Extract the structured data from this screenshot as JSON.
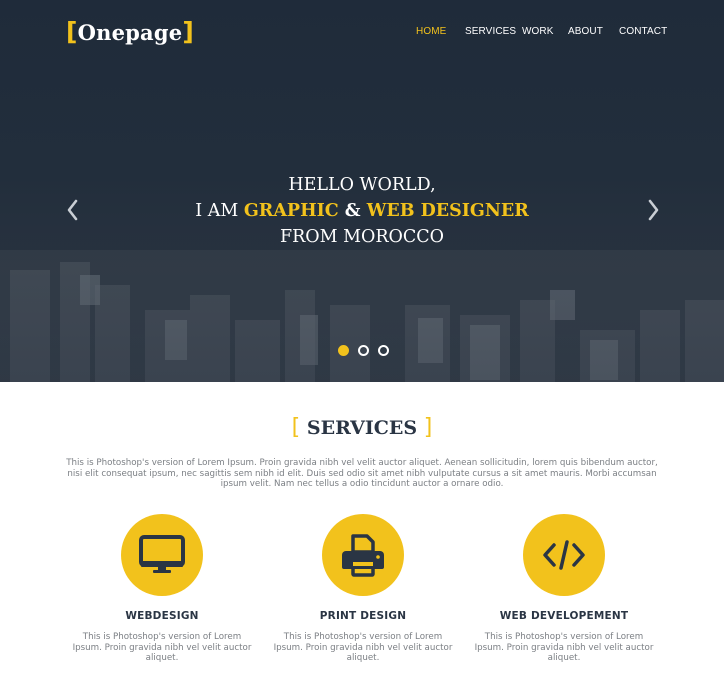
{
  "brand": {
    "logo_open": "[",
    "logo_text": "Onepage",
    "logo_close": "]",
    "accent_color": "#f2c21c",
    "dark_color": "#1f2b3a"
  },
  "nav": {
    "items": [
      {
        "label": "HOME",
        "active": true
      },
      {
        "label": "SERVICES",
        "active": false
      },
      {
        "label": "WORK",
        "active": false
      },
      {
        "label": "ABOUT",
        "active": false
      },
      {
        "label": "CONTACT",
        "active": false
      }
    ]
  },
  "hero": {
    "line1": "HELLO WORLD,",
    "line2_prefix": "I AM ",
    "line2_highlight1": "GRAPHIC",
    "line2_amp": " & ",
    "line2_highlight2": "WEB DESIGNER",
    "line3": "FROM MOROCCO",
    "prev_icon": "chevron-left-icon",
    "next_icon": "chevron-right-icon",
    "slides_total": 3,
    "active_slide": 1
  },
  "services": {
    "title_open": "[",
    "title": "SERVICES",
    "title_close": "]",
    "intro": "This is Photoshop's version  of Lorem Ipsum. Proin gravida nibh vel velit auctor aliquet. Aenean sollicitudin, lorem quis bibendum auctor, nisi elit consequat ipsum, nec sagittis sem nibh id elit. Duis sed odio sit amet nibh vulputate cursus a sit amet mauris. Morbi accumsan ipsum velit. Nam nec tellus a odio tincidunt auctor a ornare odio.",
    "items": [
      {
        "icon": "monitor-icon",
        "title": "WEBDESIGN",
        "text": "This is Photoshop's version  of Lorem Ipsum. Proin gravida nibh vel velit auctor aliquet."
      },
      {
        "icon": "printer-icon",
        "title": "PRINT DESIGN",
        "text": "This is Photoshop's version  of Lorem Ipsum. Proin gravida nibh vel velit auctor aliquet."
      },
      {
        "icon": "code-icon",
        "title": "WEB DEVELOPEMENT",
        "text": "This is Photoshop's version  of Lorem Ipsum. Proin gravida nibh vel velit auctor aliquet."
      }
    ]
  }
}
